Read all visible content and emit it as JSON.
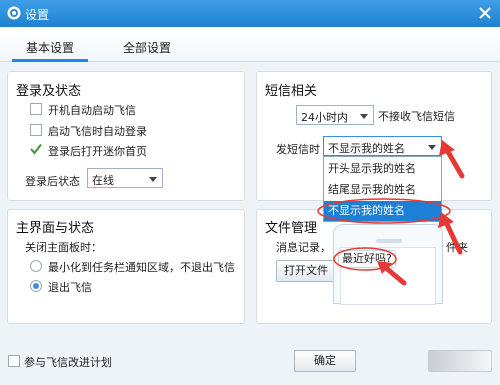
{
  "window": {
    "title": "设置"
  },
  "tabs": [
    {
      "label": "基本设置",
      "active": true
    },
    {
      "label": "全部设置",
      "active": false
    }
  ],
  "login_panel": {
    "title": "登录及状态",
    "options": [
      {
        "label": "开机自动启动飞信",
        "checked": false
      },
      {
        "label": "启动飞信时自动登录",
        "checked": false
      },
      {
        "label": "登录后打开迷你首页",
        "checked": true
      }
    ],
    "status_label": "登录后状态",
    "status_value": "在线"
  },
  "sms_panel": {
    "title": "短信相关",
    "hours_value": "24小时内",
    "no_receive_label": "不接收飞信短信",
    "send_label": "发短信时",
    "send_value": "不显示我的姓名",
    "dropdown_options": [
      "开头显示我的姓名",
      "结尾显示我的姓名",
      "不显示我的姓名"
    ],
    "selected_index": 2
  },
  "main_panel": {
    "title": "主界面与状态",
    "close_label": "关闭主面板时：",
    "radio_options": [
      {
        "label": "最小化到任务栏通知区域，不退出飞信",
        "selected": false
      },
      {
        "label": "退出飞信",
        "selected": true
      }
    ]
  },
  "file_panel": {
    "title": "文件管理",
    "desc_visible": "消息记录，",
    "desc_tail": "件夹",
    "open_button_partial": "打开文件"
  },
  "preview": {
    "bubble_text": "最近好吗?"
  },
  "footer": {
    "improve_label": "参与飞信改进计划",
    "confirm_label": "确定"
  },
  "colors": {
    "titlebar": "#1e82d2",
    "selection": "#1e7fd6",
    "annotation": "#e53935",
    "check": "#3a9a3a"
  },
  "icons": [
    "gear-icon",
    "close-icon",
    "check-icon",
    "chevron-down-icon"
  ]
}
